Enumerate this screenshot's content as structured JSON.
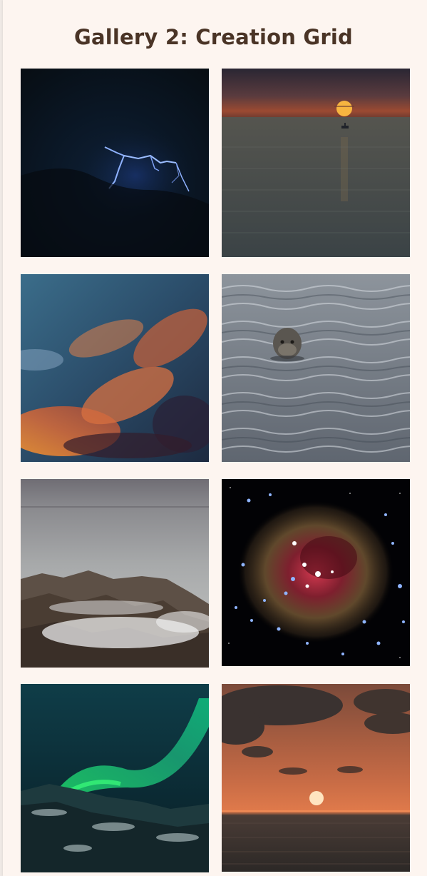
{
  "gallery": {
    "title": "Gallery 2: Creation Grid",
    "images": [
      {
        "subject": "lightning-night-sky"
      },
      {
        "subject": "sunset-sea-boat"
      },
      {
        "subject": "sunset-clouds"
      },
      {
        "subject": "seal-in-water"
      },
      {
        "subject": "misty-rocky-coast"
      },
      {
        "subject": "star-cluster-nebula"
      },
      {
        "subject": "aurora-borealis-snowy-hills"
      },
      {
        "subject": "sunset-over-sea-clouds"
      }
    ]
  },
  "colors": {
    "page_background": "#fdf5f0",
    "title_text": "#4a3426"
  }
}
